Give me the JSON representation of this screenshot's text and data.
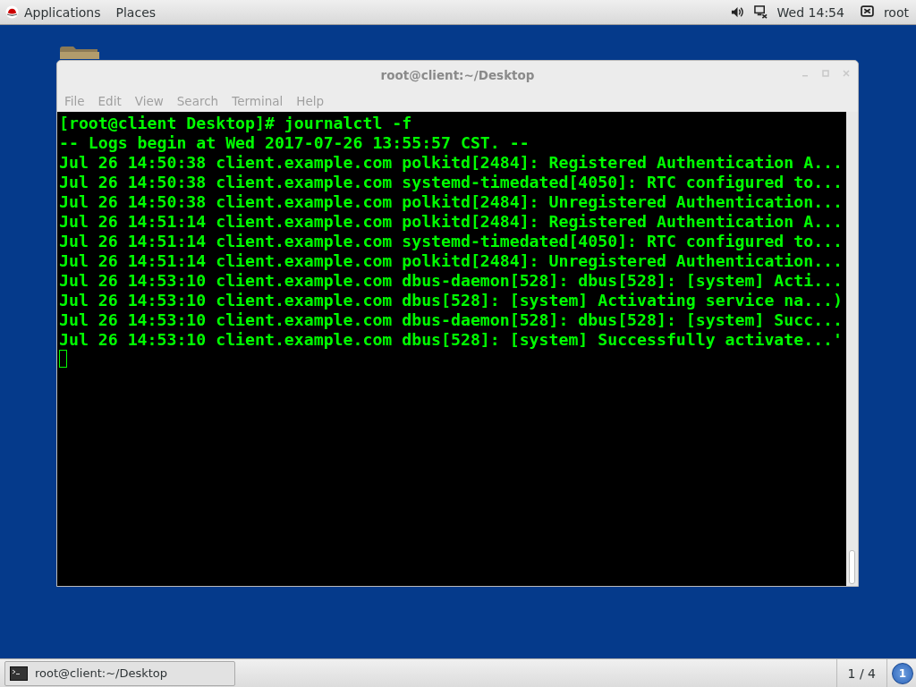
{
  "top_bar": {
    "menus": [
      "Applications",
      "Places"
    ],
    "clock": "Wed 14:54",
    "user": "root"
  },
  "window": {
    "title": "root@client:~/Desktop",
    "menu": [
      "File",
      "Edit",
      "View",
      "Search",
      "Terminal",
      "Help"
    ],
    "lines": [
      "[root@client Desktop]# journalctl -f",
      "-- Logs begin at Wed 2017-07-26 13:55:57 CST. --",
      "Jul 26 14:50:38 client.example.com polkitd[2484]: Registered Authentication A...",
      "Jul 26 14:50:38 client.example.com systemd-timedated[4050]: RTC configured to...",
      "Jul 26 14:50:38 client.example.com polkitd[2484]: Unregistered Authentication...",
      "Jul 26 14:51:14 client.example.com polkitd[2484]: Registered Authentication A...",
      "Jul 26 14:51:14 client.example.com systemd-timedated[4050]: RTC configured to...",
      "Jul 26 14:51:14 client.example.com polkitd[2484]: Unregistered Authentication...",
      "Jul 26 14:53:10 client.example.com dbus-daemon[528]: dbus[528]: [system] Acti...",
      "Jul 26 14:53:10 client.example.com dbus[528]: [system] Activating service na...)",
      "Jul 26 14:53:10 client.example.com dbus-daemon[528]: dbus[528]: [system] Succ...",
      "Jul 26 14:53:10 client.example.com dbus[528]: [system] Successfully activate...'"
    ]
  },
  "taskbar": {
    "task": "root@client:~/Desktop",
    "workspace": "1 / 4",
    "badge": "1"
  }
}
